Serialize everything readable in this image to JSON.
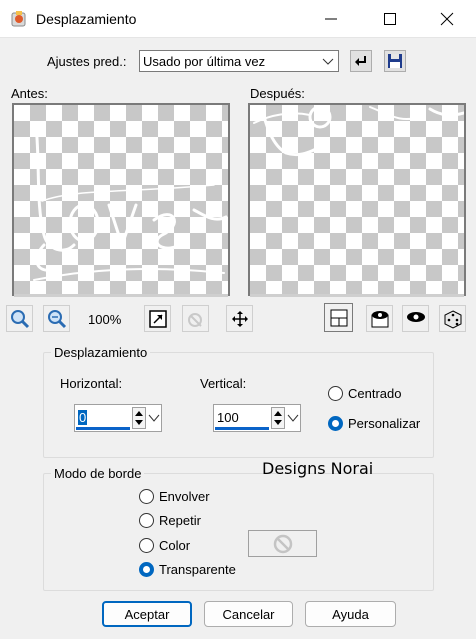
{
  "window": {
    "title": "Desplazamiento",
    "icon": "psp-app-icon"
  },
  "presets": {
    "label": "Ajustes pred.:",
    "value": "Usado por última vez",
    "reset_icon": "reset-arrow-icon",
    "save_icon": "save-floppy-icon"
  },
  "preview": {
    "before_label": "Antes:",
    "after_label": "Después:",
    "zoom": "100%",
    "zoom_in_icon": "zoom-in-icon",
    "zoom_out_icon": "zoom-out-icon",
    "fit_icon": "fit-to-window-icon",
    "lock_icon": "lock-preview-icon",
    "move_icon": "move-arrows-icon",
    "preview_toggle_icon": "preview-toggle-icon",
    "eye1_icon": "eye-preview-icon",
    "eye2_icon": "eye-proof-icon",
    "random_icon": "dice-randomize-icon"
  },
  "offset": {
    "group_label": "Desplazamiento",
    "horizontal_label": "Horizontal:",
    "horizontal_value": "0",
    "vertical_label": "Vertical:",
    "vertical_value": "100",
    "centered_label": "Centrado",
    "custom_label": "Personalizar",
    "selected": "Personalizar"
  },
  "edge": {
    "group_label": "Modo de borde",
    "options": [
      "Envolver",
      "Repetir",
      "Color",
      "Transparente"
    ],
    "selected": "Transparente",
    "watermark": "Designs Norai"
  },
  "buttons": {
    "ok": "Aceptar",
    "cancel": "Cancelar",
    "help": "Ayuda"
  },
  "colors": {
    "accent": "#0067c0",
    "checker": "#c8c8c8"
  }
}
